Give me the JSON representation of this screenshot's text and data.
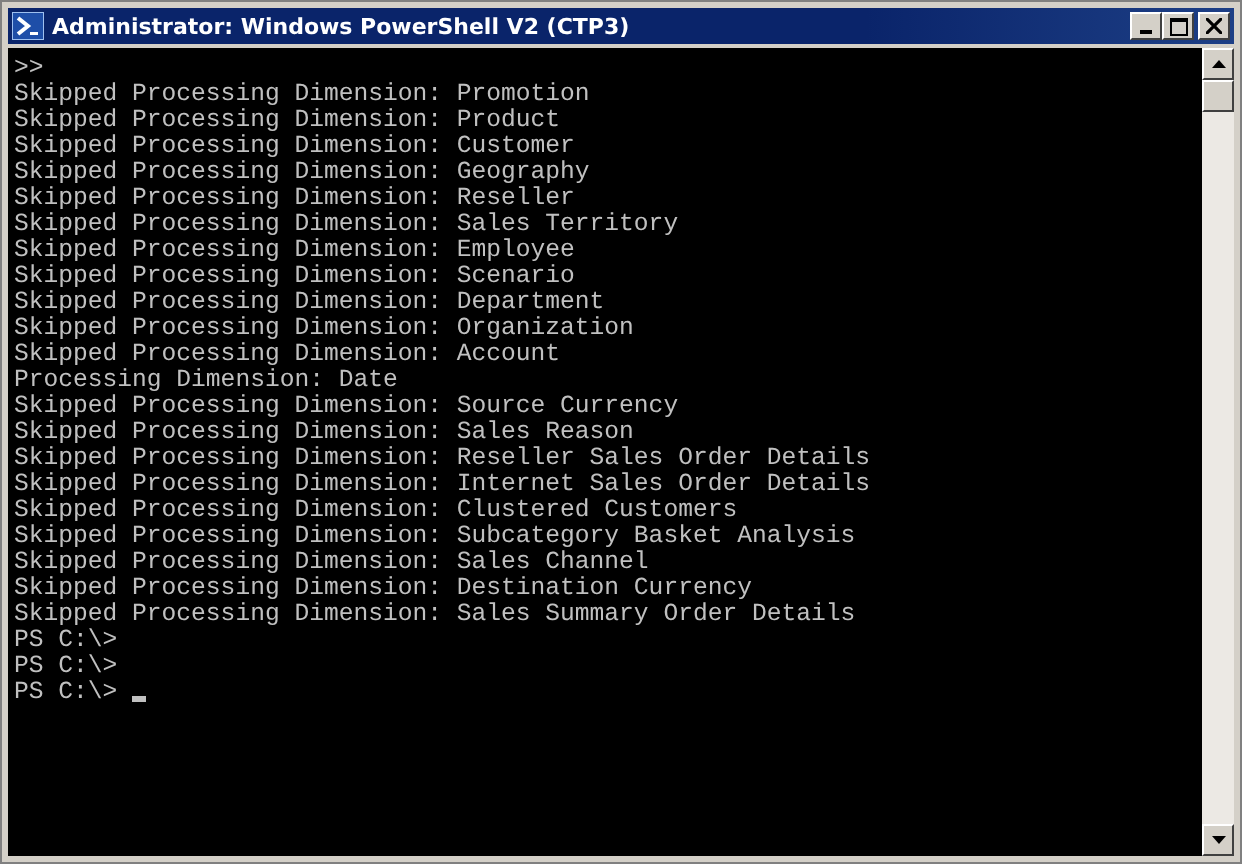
{
  "window": {
    "title": "Administrator: Windows PowerShell V2 (CTP3)"
  },
  "console": {
    "lines": [
      {
        "text": ">>",
        "cursor": false
      },
      {
        "text": "Skipped Processing Dimension: Promotion",
        "cursor": false
      },
      {
        "text": "Skipped Processing Dimension: Product",
        "cursor": false
      },
      {
        "text": "Skipped Processing Dimension: Customer",
        "cursor": false
      },
      {
        "text": "Skipped Processing Dimension: Geography",
        "cursor": false
      },
      {
        "text": "Skipped Processing Dimension: Reseller",
        "cursor": false
      },
      {
        "text": "Skipped Processing Dimension: Sales Territory",
        "cursor": false
      },
      {
        "text": "Skipped Processing Dimension: Employee",
        "cursor": false
      },
      {
        "text": "Skipped Processing Dimension: Scenario",
        "cursor": false
      },
      {
        "text": "Skipped Processing Dimension: Department",
        "cursor": false
      },
      {
        "text": "Skipped Processing Dimension: Organization",
        "cursor": false
      },
      {
        "text": "Skipped Processing Dimension: Account",
        "cursor": false
      },
      {
        "text": "Processing Dimension: Date",
        "cursor": false
      },
      {
        "text": "Skipped Processing Dimension: Source Currency",
        "cursor": false
      },
      {
        "text": "Skipped Processing Dimension: Sales Reason",
        "cursor": false
      },
      {
        "text": "Skipped Processing Dimension: Reseller Sales Order Details",
        "cursor": false
      },
      {
        "text": "Skipped Processing Dimension: Internet Sales Order Details",
        "cursor": false
      },
      {
        "text": "Skipped Processing Dimension: Clustered Customers",
        "cursor": false
      },
      {
        "text": "Skipped Processing Dimension: Subcategory Basket Analysis",
        "cursor": false
      },
      {
        "text": "Skipped Processing Dimension: Sales Channel",
        "cursor": false
      },
      {
        "text": "Skipped Processing Dimension: Destination Currency",
        "cursor": false
      },
      {
        "text": "Skipped Processing Dimension: Sales Summary Order Details",
        "cursor": false
      },
      {
        "text": "PS C:\\>",
        "cursor": false
      },
      {
        "text": "PS C:\\>",
        "cursor": false
      },
      {
        "text": "PS C:\\>",
        "cursor": true
      }
    ]
  }
}
